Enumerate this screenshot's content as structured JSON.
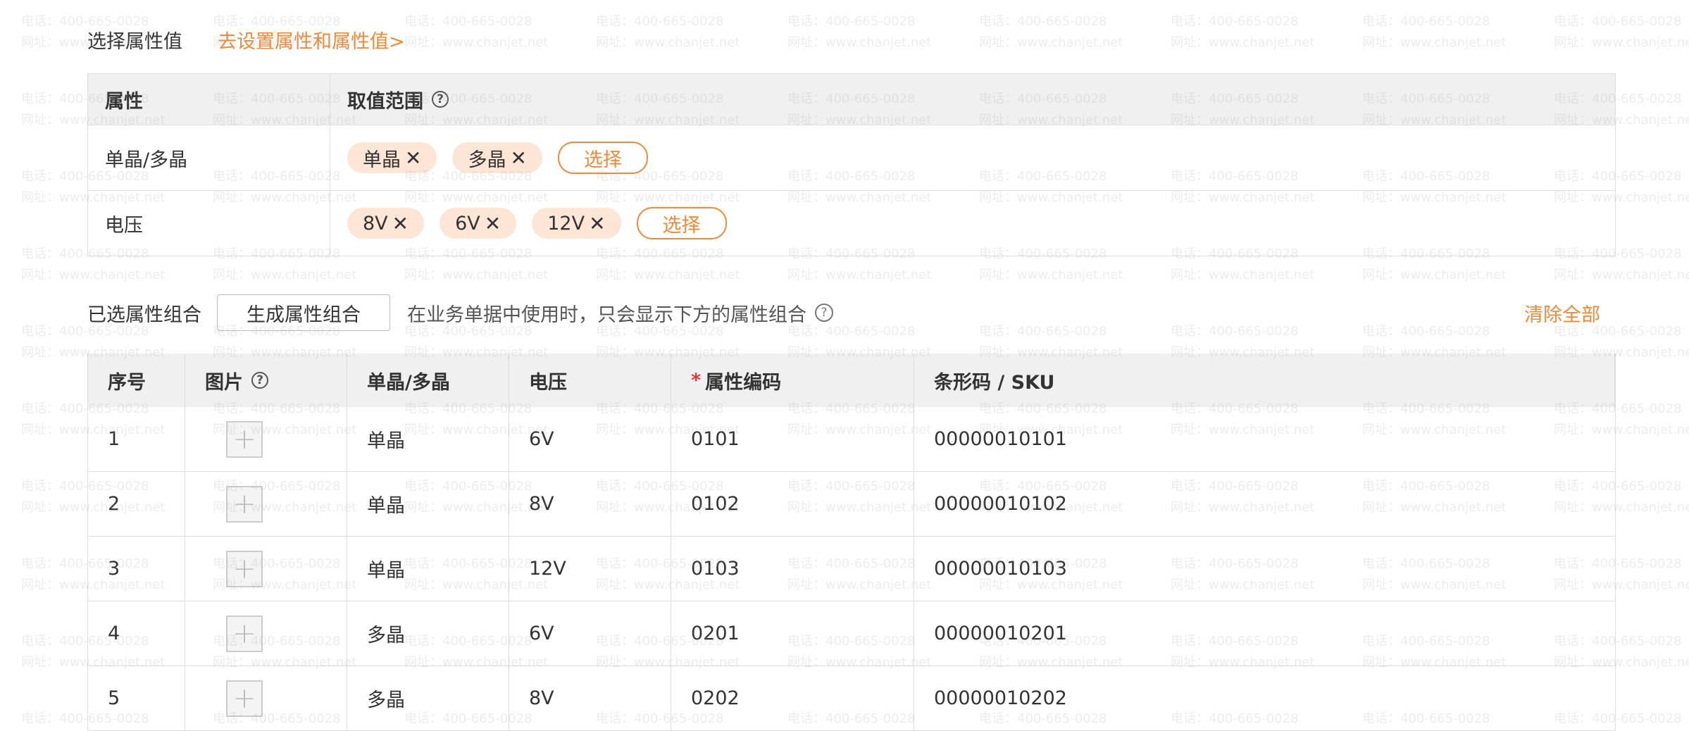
{
  "select_section": {
    "label": "选择属性值",
    "settings_link": "去设置属性和属性值>"
  },
  "attr_table": {
    "header_attr": "属性",
    "header_range": "取值范围",
    "help_glyph": "?",
    "rows": [
      {
        "name": "单晶/多晶",
        "values": [
          "单晶",
          "多晶"
        ],
        "select_label": "选择"
      },
      {
        "name": "电压",
        "values": [
          "8V",
          "6V",
          "12V"
        ],
        "select_label": "选择"
      }
    ],
    "remove_glyph": "✕"
  },
  "combo_section": {
    "label": "已选属性组合",
    "generate_button": "生成属性组合",
    "hint": "在业务单据中使用时，只会显示下方的属性组合",
    "hint_glyph": "?",
    "clear_all": "清除全部"
  },
  "sku_table": {
    "headers": {
      "index": "序号",
      "image": "图片",
      "crystal": "单晶/多晶",
      "voltage": "电压",
      "required_mark": "*",
      "code": "属性编码",
      "barcode": "条形码 / SKU"
    },
    "add_glyph": "+",
    "rows": [
      {
        "index": "1",
        "crystal": "单晶",
        "voltage": "6V",
        "code": "0101",
        "barcode": "00000010101"
      },
      {
        "index": "2",
        "crystal": "单晶",
        "voltage": "8V",
        "code": "0102",
        "barcode": "00000010102"
      },
      {
        "index": "3",
        "crystal": "单晶",
        "voltage": "12V",
        "code": "0103",
        "barcode": "00000010103"
      },
      {
        "index": "4",
        "crystal": "多晶",
        "voltage": "6V",
        "code": "0201",
        "barcode": "00000010201"
      },
      {
        "index": "5",
        "crystal": "多晶",
        "voltage": "8V",
        "code": "0202",
        "barcode": "00000010202"
      }
    ]
  },
  "watermark": {
    "line1": "电话：400-665-0028",
    "line2": "网址：www.chanjet.net"
  },
  "colors": {
    "accent": "#f08a3a",
    "chip_bg": "#fde6d6",
    "header_bg": "#f0f0f0",
    "required": "#e03a3a"
  }
}
